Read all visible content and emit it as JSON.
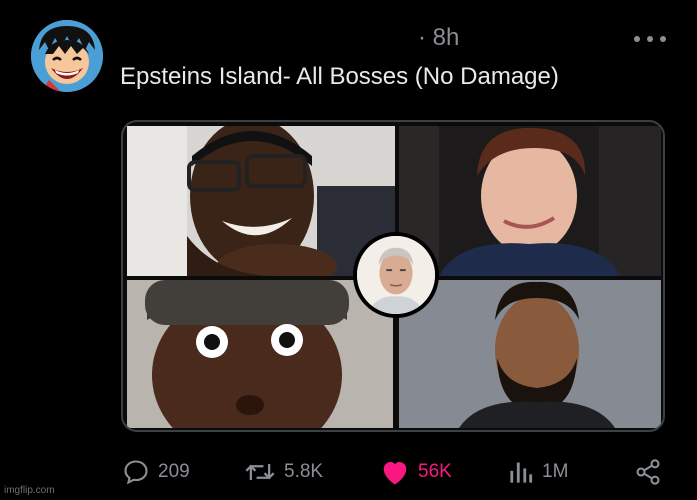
{
  "post": {
    "timestamp": "· 8h",
    "text": "Epsteins Island- All Bosses (No Damage)"
  },
  "actions": {
    "replies": "209",
    "reposts": "5.8K",
    "likes": "56K",
    "views": "1M"
  },
  "icons": {
    "more": "more-horizontal-icon",
    "reply": "reply-icon",
    "repost": "repost-icon",
    "like": "heart-icon",
    "views": "views-bar-chart-icon",
    "share": "share-icon"
  },
  "colors": {
    "background": "#000000",
    "text": "#e7e9ea",
    "muted": "#8b8f94",
    "like": "#f91880"
  },
  "watermark": "imgflip.com"
}
